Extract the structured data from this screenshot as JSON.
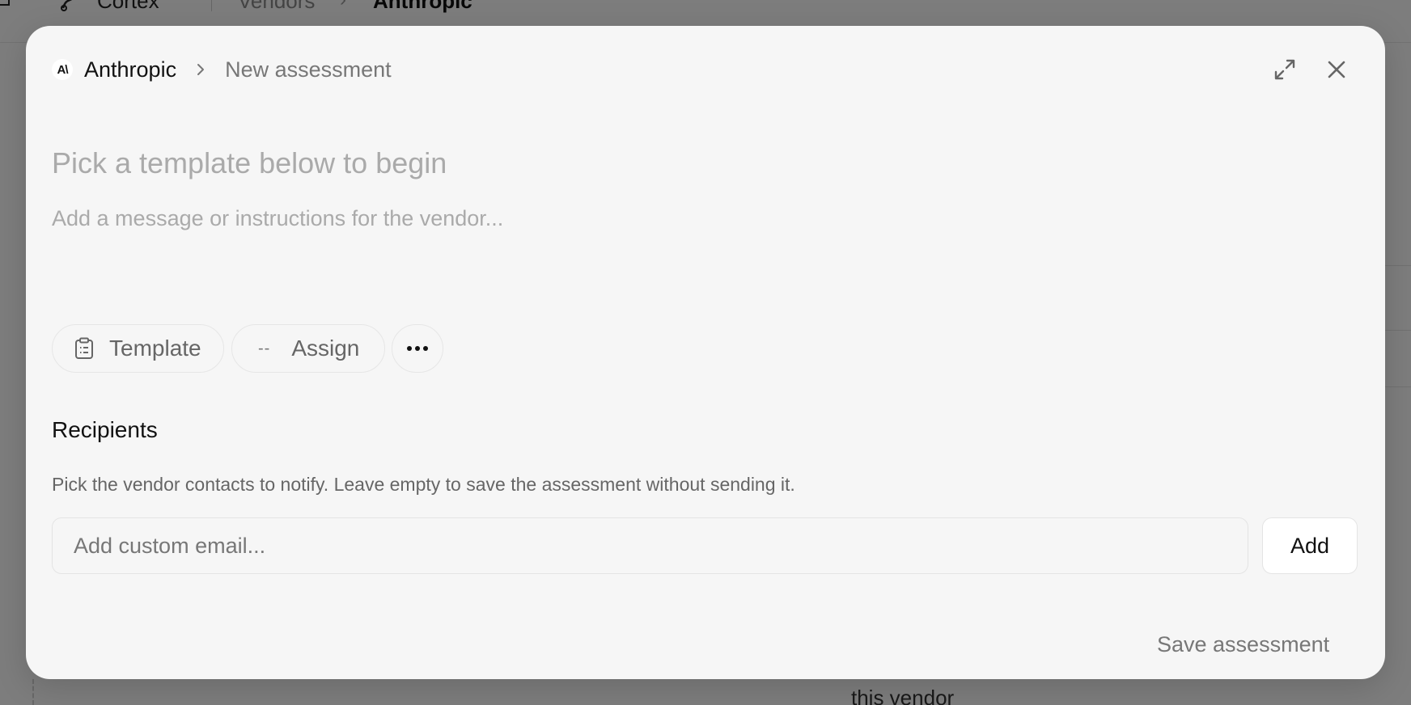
{
  "background": {
    "app_name": "Cortex",
    "breadcrumb": [
      "Vendors",
      "Anthropic"
    ],
    "footer_fragment": "this vendor"
  },
  "modal": {
    "vendor_logo_text": "A\\",
    "vendor_name": "Anthropic",
    "title": "New assessment",
    "title_placeholder": "Pick a template below to begin",
    "message_placeholder": "Add a message or instructions for the vendor...",
    "chips": {
      "template_label": "Template",
      "assign_prefix": "--",
      "assign_label": "Assign"
    },
    "recipients": {
      "heading": "Recipients",
      "help": "Pick the vendor contacts to notify. Leave empty to save the assessment without sending it.",
      "email_placeholder": "Add custom email...",
      "add_label": "Add"
    },
    "save_label": "Save assessment"
  },
  "icons": {
    "expand": "expand-icon",
    "close": "close-icon",
    "template": "clipboard-icon",
    "more": "more-horizontal-icon",
    "chevron": "chevron-right-icon"
  },
  "colors": {
    "overlay": "#7f7f7f",
    "modal_bg": "#f6f6f6",
    "placeholder": "#aaaaaa",
    "text": "#111111",
    "muted": "#777777"
  }
}
